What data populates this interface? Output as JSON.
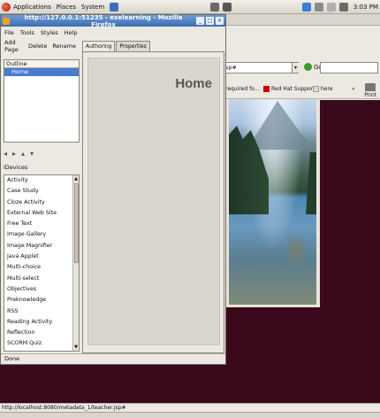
{
  "panel": {
    "menus": [
      "Applications",
      "Places",
      "System"
    ],
    "clock": "3:03 PM"
  },
  "exe_window": {
    "title": "http://127.0.0.1:51235 - exelearning - Mozilla Firefox",
    "menu": [
      "File",
      "Tools",
      "Styles",
      "Help"
    ],
    "toolbar": [
      "Add Page",
      "Delete",
      "Rename"
    ],
    "outline_header": "Outline",
    "outline_selected": "Home",
    "idevices_header": "iDevices",
    "idevices": [
      "Activity",
      "Case Study",
      "Cloze Activity",
      "External Web Site",
      "Free Text",
      "Image Gallery",
      "Image Magnifier",
      "Java Applet",
      "Multi-choice",
      "Multi-select",
      "Objectives",
      "Preknowledge",
      "RSS",
      "Reading Activity",
      "Reflection",
      "SCORM Quiz"
    ],
    "tabs": [
      "Authoring",
      "Properties"
    ],
    "page_title": "Home",
    "status": "Done"
  },
  "bg_window": {
    "url": "jsp#",
    "go_label": "Go",
    "bookmarks": [
      "s required fo...",
      "Red Hat Support",
      "here"
    ],
    "print_label": "Print",
    "status_url": "http://localhost:8080/metadata_1/teacher.jsp#"
  },
  "colors": {
    "titlebar": "#3c6eb4",
    "selection": "#4a7ccd",
    "background": "#3a0a1c"
  }
}
